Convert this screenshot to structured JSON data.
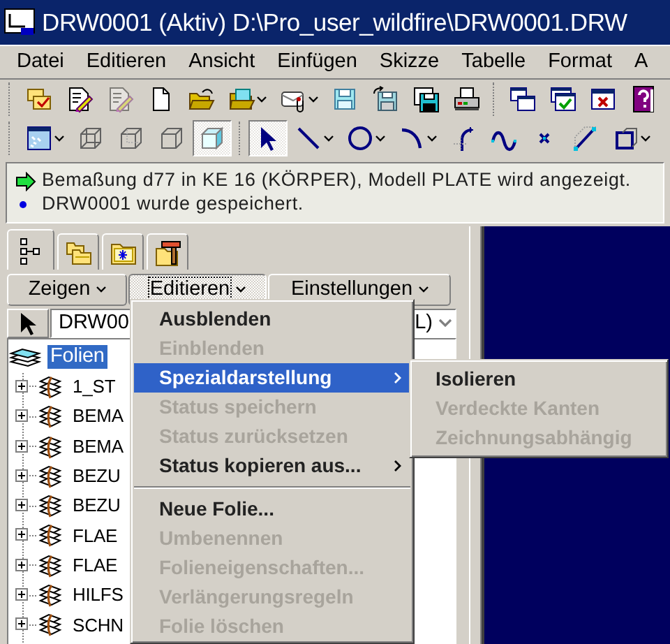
{
  "window": {
    "title": "DRW0001 (Aktiv) D:\\Pro_user_wildfire\\DRW0001.DRW"
  },
  "menu_bar": [
    {
      "label": "Datei"
    },
    {
      "label": "Editieren"
    },
    {
      "label": "Ansicht"
    },
    {
      "label": "Einfügen"
    },
    {
      "label": "Skizze"
    },
    {
      "label": "Tabelle"
    },
    {
      "label": "Format"
    },
    {
      "label": "A"
    }
  ],
  "toolbars": [
    [
      {
        "kind": "button",
        "pressed": false,
        "disabled": false
      },
      {
        "kind": "button",
        "pressed": false,
        "disabled": false
      },
      {
        "kind": "button",
        "pressed": false,
        "disabled": true
      },
      {
        "kind": "button",
        "pressed": false,
        "disabled": false
      },
      {
        "kind": "button",
        "pressed": false,
        "disabled": false
      },
      {
        "kind": "dropdown",
        "pressed": false,
        "disabled": false
      },
      {
        "kind": "dropdown",
        "pressed": false,
        "disabled": false
      },
      {
        "kind": "button",
        "pressed": false,
        "disabled": false
      },
      {
        "kind": "button",
        "pressed": false,
        "disabled": false
      },
      {
        "kind": "button",
        "pressed": false,
        "disabled": false
      },
      {
        "kind": "button",
        "pressed": false,
        "disabled": false
      },
      {
        "kind": "separator"
      },
      {
        "kind": "button",
        "pressed": false,
        "disabled": false
      },
      {
        "kind": "button",
        "pressed": false,
        "disabled": false
      },
      {
        "kind": "button",
        "pressed": false,
        "disabled": false
      },
      {
        "kind": "button",
        "pressed": false,
        "disabled": false
      }
    ],
    [
      {
        "kind": "dropdown",
        "pressed": false,
        "disabled": false
      },
      {
        "kind": "button",
        "pressed": false,
        "disabled": false
      },
      {
        "kind": "button",
        "pressed": false,
        "disabled": false
      },
      {
        "kind": "button",
        "pressed": false,
        "disabled": false
      },
      {
        "kind": "button",
        "pressed": true,
        "disabled": false
      },
      {
        "kind": "separator"
      },
      {
        "kind": "button",
        "pressed": true,
        "disabled": false
      },
      {
        "kind": "dropdown",
        "pressed": false,
        "disabled": false
      },
      {
        "kind": "dropdown",
        "pressed": false,
        "disabled": false
      },
      {
        "kind": "dropdown",
        "pressed": false,
        "disabled": false
      },
      {
        "kind": "button",
        "pressed": false,
        "disabled": false
      },
      {
        "kind": "button",
        "pressed": false,
        "disabled": false
      },
      {
        "kind": "button",
        "pressed": false,
        "disabled": false
      },
      {
        "kind": "button",
        "pressed": false,
        "disabled": false
      },
      {
        "kind": "dropdown",
        "pressed": false,
        "disabled": false
      }
    ]
  ],
  "messages": [
    {
      "kind": "arrow",
      "text": "Bemaßung d77 in KE 16 (KÖRPER), Modell PLATE wird angezeigt."
    },
    {
      "kind": "bullet",
      "text": "DRW0001 wurde gespeichert."
    }
  ],
  "panel_tabs": [
    {
      "selected": true
    },
    {
      "selected": false
    },
    {
      "selected": false
    },
    {
      "selected": false
    }
  ],
  "panel_buttons": [
    {
      "label": "Zeigen",
      "pressed": false
    },
    {
      "label": "Editieren",
      "pressed": true
    },
    {
      "label": "Einstellungen",
      "pressed": false
    }
  ],
  "layer_combo": {
    "value_start": "DRW00",
    "value_end": "L)"
  },
  "tree": {
    "label": "Folien",
    "selected": true,
    "children": [
      {
        "label": "1_ST",
        "expanded": false
      },
      {
        "label": "BEMA",
        "expanded": false
      },
      {
        "label": "BEMA",
        "expanded": false
      },
      {
        "label": "BEZU",
        "expanded": false
      },
      {
        "label": "BEZU",
        "expanded": false
      },
      {
        "label": "FLAE",
        "expanded": false
      },
      {
        "label": "FLAE",
        "expanded": false
      },
      {
        "label": "HILFS",
        "expanded": false
      },
      {
        "label": "SCHN",
        "expanded": false
      }
    ]
  },
  "context_menu": [
    {
      "kind": "item",
      "label": "Ausblenden",
      "disabled": false,
      "highlighted": false,
      "submenu": false
    },
    {
      "kind": "item",
      "label": "Einblenden",
      "disabled": true,
      "highlighted": false,
      "submenu": false
    },
    {
      "kind": "item",
      "label": "Spezialdarstellung",
      "disabled": false,
      "highlighted": true,
      "submenu": true
    },
    {
      "kind": "item",
      "label": "Status speichern",
      "disabled": true,
      "highlighted": false,
      "submenu": false
    },
    {
      "kind": "item",
      "label": "Status zurücksetzen",
      "disabled": true,
      "highlighted": false,
      "submenu": false
    },
    {
      "kind": "item",
      "label": "Status kopieren aus...",
      "disabled": false,
      "highlighted": false,
      "submenu": true
    },
    {
      "kind": "separator"
    },
    {
      "kind": "item",
      "label": "Neue Folie...",
      "disabled": false,
      "highlighted": false,
      "submenu": false
    },
    {
      "kind": "item",
      "label": "Umbenennen",
      "disabled": true,
      "highlighted": false,
      "submenu": false
    },
    {
      "kind": "item",
      "label": "Folieneigenschaften...",
      "disabled": true,
      "highlighted": false,
      "submenu": false
    },
    {
      "kind": "item",
      "label": "Verlängerungsregeln",
      "disabled": true,
      "highlighted": false,
      "submenu": false
    },
    {
      "kind": "item",
      "label": "Folie löschen",
      "disabled": true,
      "highlighted": false,
      "submenu": false
    }
  ],
  "submenu": [
    {
      "label": "Isolieren",
      "disabled": false
    },
    {
      "label": "Verdeckte Kanten",
      "disabled": true
    },
    {
      "label": "Zeichnungsabhängig",
      "disabled": true
    }
  ]
}
